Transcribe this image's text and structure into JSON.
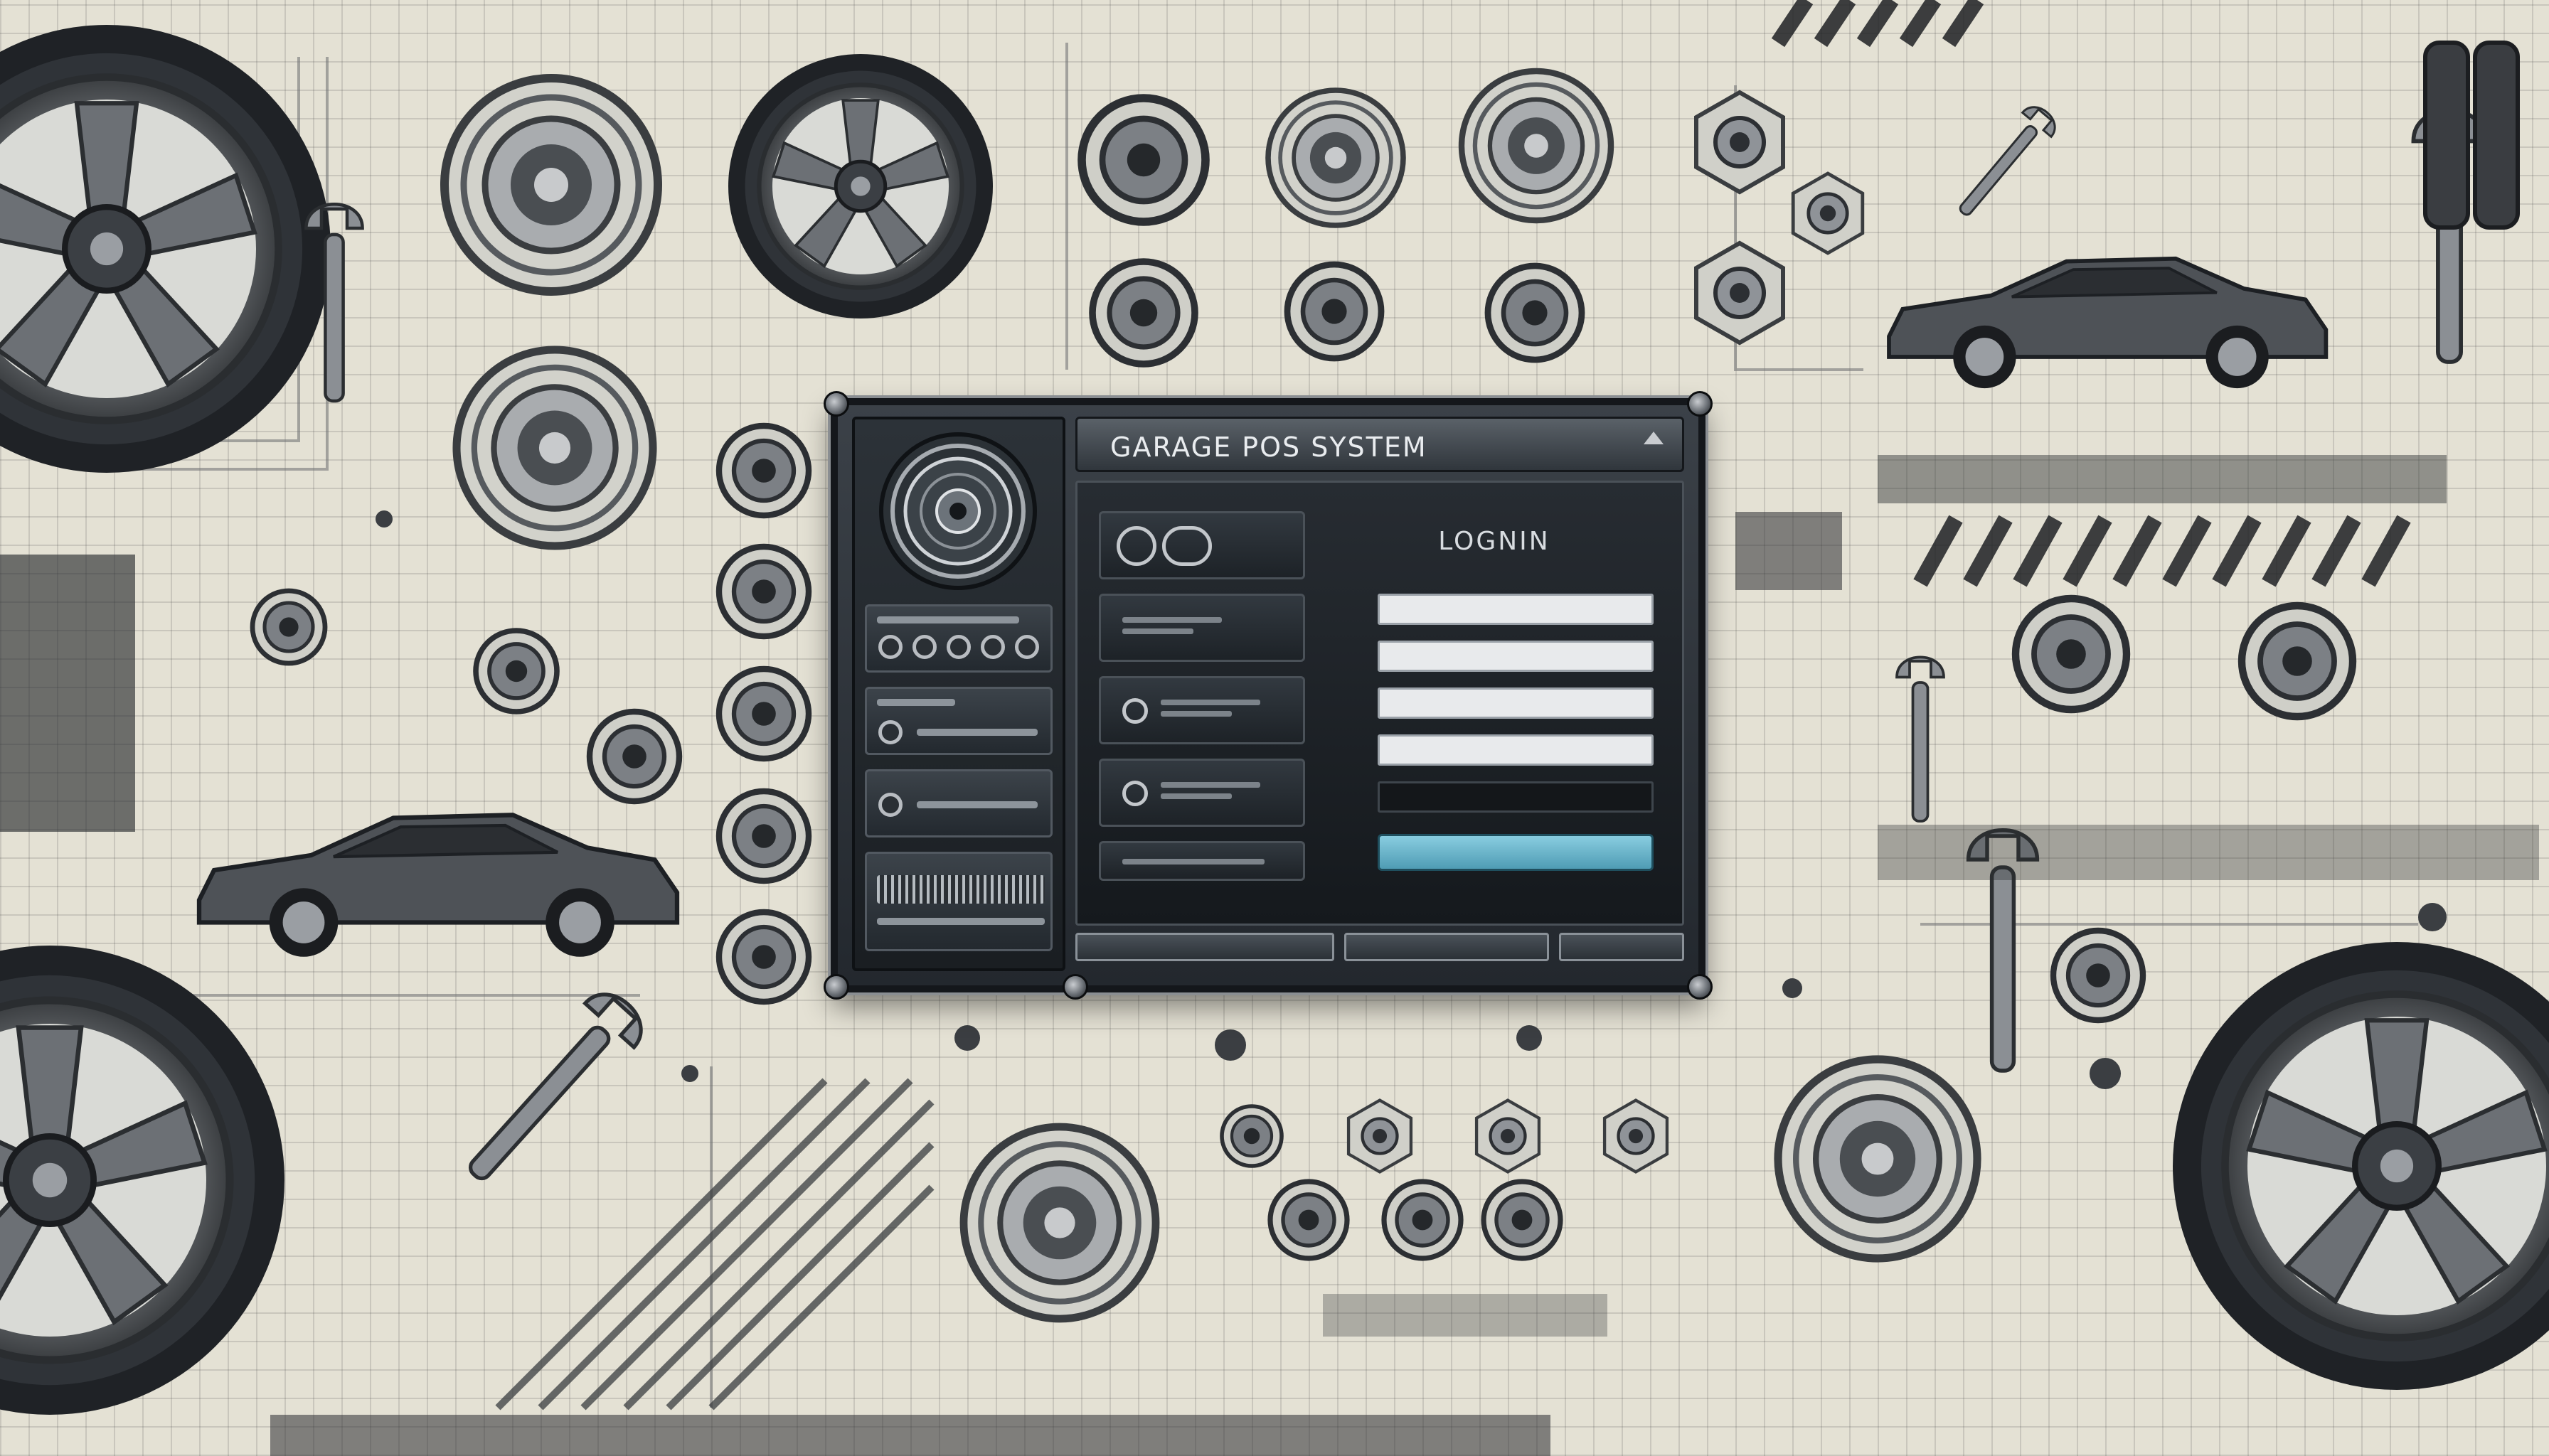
{
  "window": {
    "title": "GARAGE POS SYSTEM"
  },
  "login": {
    "title": "LOGNIN"
  },
  "colors": {
    "background": "#e4e1d4",
    "window_frame": "#14171b",
    "window_body": "#23282e",
    "accent_button": "#6bb3ca"
  },
  "icons": [
    "wheel-icon",
    "gear-icon",
    "wrench-icon",
    "car-icon",
    "spanner-icon",
    "hex-nut-icon"
  ]
}
